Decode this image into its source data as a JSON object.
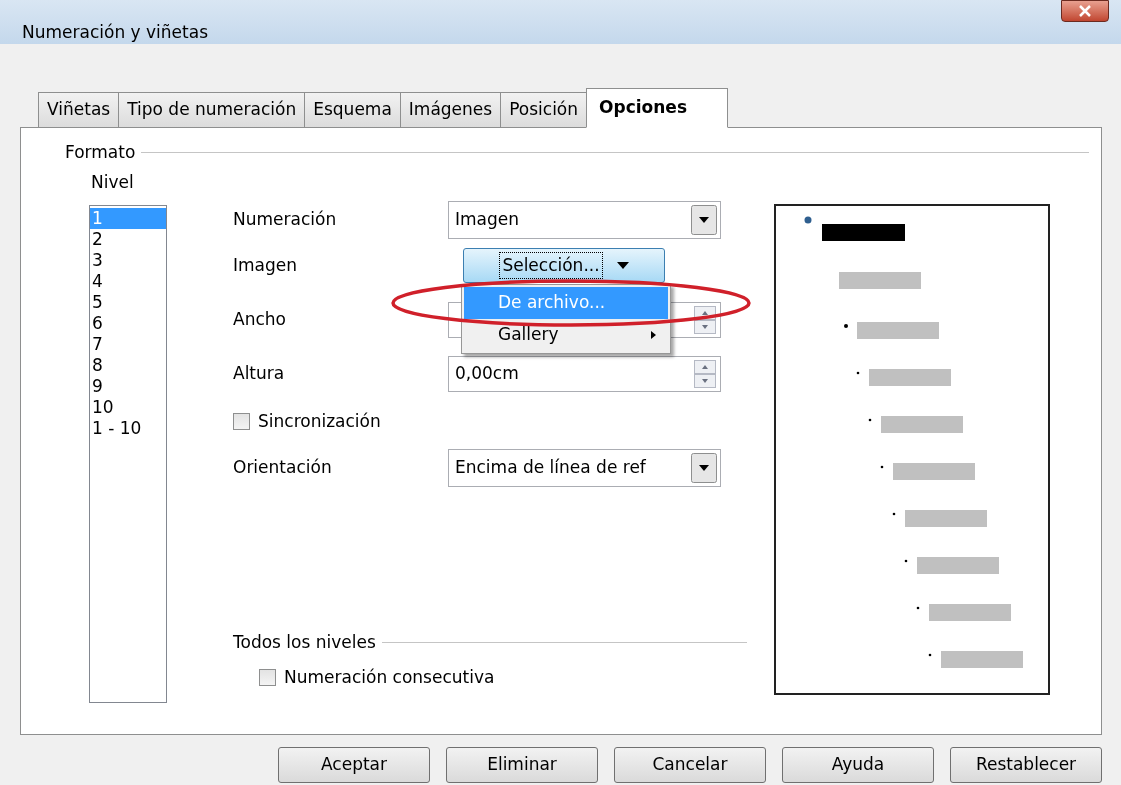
{
  "window": {
    "title": "Numeración y viñetas"
  },
  "tabs": [
    {
      "label": "Viñetas",
      "selected": false
    },
    {
      "label": "Tipo de numeración",
      "selected": false
    },
    {
      "label": "Esquema",
      "selected": false
    },
    {
      "label": "Imágenes",
      "selected": false
    },
    {
      "label": "Posición",
      "selected": false
    },
    {
      "label": "Opciones",
      "selected": true
    }
  ],
  "format_group": {
    "legend": "Formato",
    "level_label": "Nivel",
    "levels": [
      {
        "label": "1",
        "selected": true
      },
      {
        "label": "2",
        "selected": false
      },
      {
        "label": "3",
        "selected": false
      },
      {
        "label": "4",
        "selected": false
      },
      {
        "label": "5",
        "selected": false
      },
      {
        "label": "6",
        "selected": false
      },
      {
        "label": "7",
        "selected": false
      },
      {
        "label": "8",
        "selected": false
      },
      {
        "label": "9",
        "selected": false
      },
      {
        "label": "10",
        "selected": false
      },
      {
        "label": "1 - 10",
        "selected": false
      }
    ]
  },
  "numbering": {
    "label": "Numeración",
    "value": "Imagen"
  },
  "image": {
    "label": "Imagen",
    "button": "Selección...",
    "menu": [
      {
        "label": "De archivo...",
        "selected": true,
        "has_submenu": false
      },
      {
        "label": "Gallery",
        "selected": false,
        "has_submenu": true
      }
    ]
  },
  "width": {
    "label": "Ancho"
  },
  "height": {
    "label": "Altura",
    "value": "0,00cm"
  },
  "sync": {
    "label": "Sincronización",
    "checked": false
  },
  "orientation": {
    "label": "Orientación",
    "value": "Encima de línea de ref"
  },
  "all_levels": {
    "legend": "Todos los niveles",
    "consecutive": {
      "label": "Numeración consecutiva",
      "checked": false
    }
  },
  "buttons": [
    "Aceptar",
    "Eliminar",
    "Cancelar",
    "Ayuda",
    "Restablecer"
  ]
}
